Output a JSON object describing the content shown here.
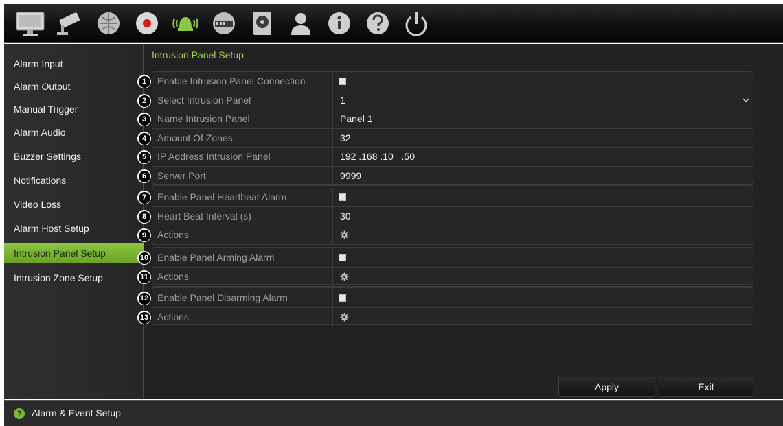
{
  "toolbar": {
    "icons": [
      "monitor-icon",
      "camera-icon",
      "network-icon",
      "record-icon",
      "alarm-icon",
      "device-icon",
      "hdd-icon",
      "user-icon",
      "info-icon",
      "help-icon",
      "power-icon"
    ]
  },
  "sidebar": {
    "items": [
      {
        "label": "Alarm Input"
      },
      {
        "label": "Alarm Output"
      },
      {
        "label": "Manual Trigger"
      },
      {
        "label": "Alarm Audio"
      },
      {
        "label": "Buzzer Settings"
      },
      {
        "label": "Notifications"
      },
      {
        "label": "Video Loss"
      },
      {
        "label": "Alarm Host Setup"
      },
      {
        "label": "Intrusion Panel Setup"
      },
      {
        "label": "Intrusion Zone Setup"
      }
    ],
    "active_index": 8
  },
  "main": {
    "title": "Intrusion Panel Setup",
    "rows": [
      {
        "num": "1",
        "label": "Enable Intrusion Panel Connection",
        "type": "checkbox",
        "value": ""
      },
      {
        "num": "2",
        "label": "Select Intrusion Panel",
        "type": "dropdown",
        "value": "1"
      },
      {
        "num": "3",
        "label": "Name Intrusion Panel",
        "type": "text",
        "value": "Panel 1"
      },
      {
        "num": "4",
        "label": "Amount Of Zones",
        "type": "text",
        "value": "32"
      },
      {
        "num": "5",
        "label": "IP Address Intrusion Panel",
        "type": "text",
        "value": "192 .168 .10   .50"
      },
      {
        "num": "6",
        "label": "Server Port",
        "type": "text",
        "value": "9999"
      },
      {
        "num": "7",
        "label": "Enable Panel Heartbeat Alarm",
        "type": "checkbox",
        "value": ""
      },
      {
        "num": "8",
        "label": "Heart Beat Interval (s)",
        "type": "text",
        "value": "30"
      },
      {
        "num": "9",
        "label": "Actions",
        "type": "gear",
        "value": ""
      },
      {
        "num": "10",
        "label": "Enable Panel Arming Alarm",
        "type": "checkbox",
        "value": ""
      },
      {
        "num": "11",
        "label": "Actions",
        "type": "gear",
        "value": ""
      },
      {
        "num": "12",
        "label": "Enable Panel Disarming Alarm",
        "type": "checkbox",
        "value": ""
      },
      {
        "num": "13",
        "label": "Actions",
        "type": "gear",
        "value": ""
      }
    ],
    "apply_label": "Apply",
    "exit_label": "Exit"
  },
  "statusbar": {
    "icon": "help-circle-icon",
    "text": "Alarm & Event Setup"
  },
  "colors": {
    "accent": "#8dc63f",
    "title": "#a6d24a"
  }
}
